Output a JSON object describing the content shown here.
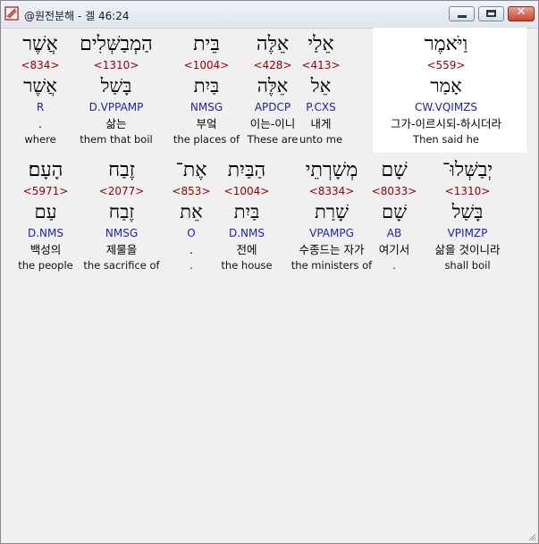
{
  "window": {
    "title": "@원전분해 - 겔 46:24",
    "controls": {
      "minimize": "minimize",
      "maximize": "maximize",
      "close": "✕"
    }
  },
  "rows": [
    [
      {
        "hebrew": "וַיֹּאמֶר",
        "strong": "<559>",
        "root": "אָמַר",
        "parse": "CW.VQIMZS",
        "korean": "그가-이르시되-하시더라",
        "english": "Then said he",
        "highlight": true
      },
      {
        "hebrew": "אֵלַי",
        "strong": "<413>",
        "root": "אֵל",
        "parse": "P.CXS",
        "korean": "내게",
        "english": "unto me"
      },
      {
        "hebrew": "אֵלֶּה",
        "strong": "<428>",
        "root": "אֵלֶּה",
        "parse": "APDCP",
        "korean": "이는-이니",
        "english": "These are"
      },
      {
        "hebrew": "בֵּית",
        "strong": "<1004>",
        "root": "בַּיִת",
        "parse": "NMSG",
        "korean": "부엌",
        "english": "the places of"
      },
      {
        "hebrew": "הַמְבַשְּׁלִים",
        "strong": "<1310>",
        "root": "בָּשַׁל",
        "parse": "D.VPPAMP",
        "korean": "삶는",
        "english": "them that boil"
      },
      {
        "hebrew": "אֲשֶׁר",
        "strong": "<834>",
        "root": "אֲשֶׁר",
        "parse": "R",
        "korean": ".",
        "english": "where"
      }
    ],
    [
      {
        "hebrew": "יְבַשְּׁלוּ־",
        "strong": "<1310>",
        "root": "בָּשַׁל",
        "parse": "VPIMZP",
        "korean": "삶을 것이니라",
        "english": "shall boil"
      },
      {
        "hebrew": "שָׁם",
        "strong": "<8033>",
        "root": "שָׁם",
        "parse": "AB",
        "korean": "여기서",
        "english": "."
      },
      {
        "hebrew": "מְשָׁרְתֵי",
        "strong": "<8334>",
        "root": "שָׁרַת",
        "parse": "VPAMPG",
        "korean": "수종드는 자가",
        "english": "the ministers of"
      },
      {
        "hebrew": "הַבַּיִת",
        "strong": "<1004>",
        "root": "בַּיִת",
        "parse": "D.NMS",
        "korean": "전에",
        "english": "the house"
      },
      {
        "hebrew": "אֶת־",
        "strong": "<853>",
        "root": "אֵת",
        "parse": "O",
        "korean": ".",
        "english": "."
      },
      {
        "hebrew": "זֶבַח",
        "strong": "<2077>",
        "root": "זֶבַח",
        "parse": "NMSG",
        "korean": "제물을",
        "english": "the sacrifice of"
      },
      {
        "hebrew": "הָעָם׃",
        "strong": "<5971>",
        "root": "עַם",
        "parse": "D.NMS",
        "korean": "백성의",
        "english": "the people"
      }
    ]
  ],
  "colors": {
    "strong": "#a00000",
    "parse": "#1a24b4",
    "background": "#f0f0f0",
    "highlight": "#ffffff"
  }
}
